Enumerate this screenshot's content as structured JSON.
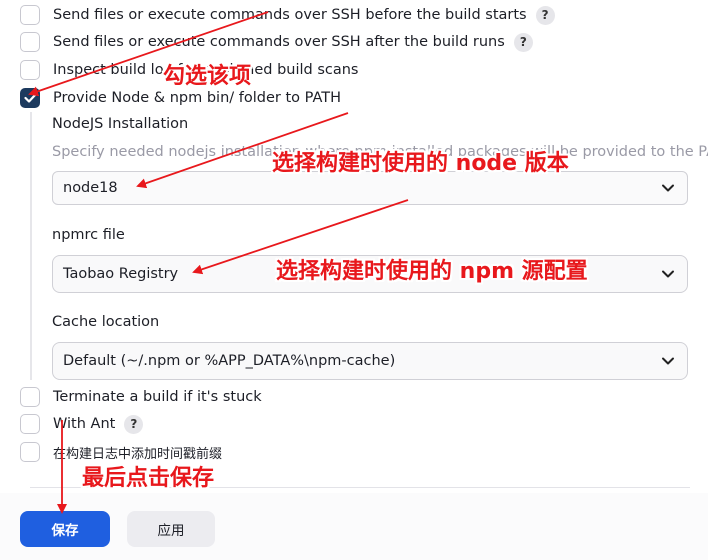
{
  "options": [
    {
      "label": "Send files or execute commands over SSH before the build starts",
      "checked": false,
      "help": "?"
    },
    {
      "label": "Send files or execute commands over SSH after the build runs",
      "checked": false,
      "help": "?"
    },
    {
      "label": "Inspect build log for published build scans",
      "checked": false
    },
    {
      "label": "Provide Node & npm bin/ folder to PATH",
      "checked": true
    }
  ],
  "node_section": {
    "nodejs_installation_label": "NodeJS Installation",
    "nodejs_hint": "Specify needed nodejs installation where npm installed packages will be provided to the PATH",
    "nodejs_selected": "node18",
    "npmrc_label": "npmrc file",
    "npmrc_selected": "Taobao Registry",
    "cache_label": "Cache location",
    "cache_selected": "Default (~/.npm or %APP_DATA%\\npm-cache)"
  },
  "options_after": [
    {
      "label": "Terminate a build if it's stuck",
      "checked": false
    },
    {
      "label": "With Ant",
      "checked": false,
      "help": "?"
    },
    {
      "label": "在构建日志中添加时间戳前缀",
      "checked": false
    }
  ],
  "buttons": {
    "save": "保存",
    "apply": "应用"
  },
  "annotations": {
    "check": "勾选该项",
    "node": "选择构建时使用的 node 版本",
    "npm": "选择构建时使用的 npm 源配置",
    "save": "最后点击保存"
  },
  "colors": {
    "primary": "#1f5fe0",
    "checked": "#1c3a5e",
    "annotation": "#e8181c"
  }
}
